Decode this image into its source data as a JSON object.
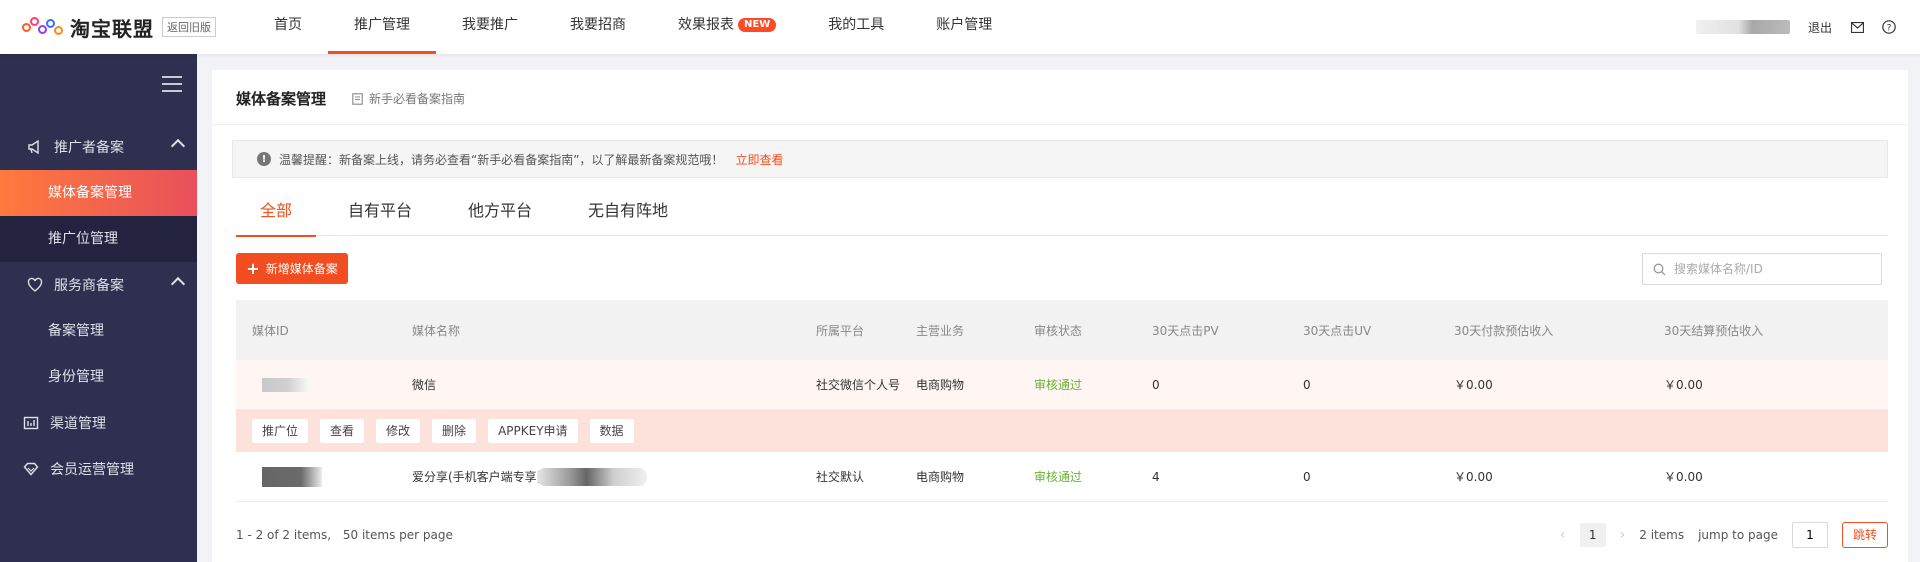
{
  "brand": {
    "name": "淘宝联盟",
    "old_version": "返回旧版"
  },
  "nav": [
    {
      "label": "首页",
      "active": false
    },
    {
      "label": "推广管理",
      "active": true
    },
    {
      "label": "我要推广",
      "active": false
    },
    {
      "label": "我要招商",
      "active": false
    },
    {
      "label": "效果报表",
      "badge": "NEW",
      "active": false
    },
    {
      "label": "我的工具",
      "active": false
    },
    {
      "label": "账户管理",
      "active": false
    }
  ],
  "topright": {
    "logout": "退出"
  },
  "sidebar": {
    "groups": [
      {
        "label": "推广者备案",
        "items": [
          "媒体备案管理",
          "推广位管理"
        ]
      },
      {
        "label": "服务商备案",
        "items": [
          "备案管理",
          "身份管理"
        ]
      },
      {
        "label": "渠道管理"
      },
      {
        "label": "会员运营管理"
      }
    ]
  },
  "page": {
    "title": "媒体备案管理",
    "guide_link": "新手必看备案指南",
    "notice": "温馨提醒：新备案上线，请务必查看“新手必看备案指南”，以了解最新备案规范哦！",
    "notice_link": "立即查看",
    "tabs": [
      "全部",
      "自有平台",
      "他方平台",
      "无自有阵地"
    ],
    "add_button": "新增媒体备案",
    "search_placeholder": "搜索媒体名称/ID"
  },
  "table": {
    "columns": [
      "媒体ID",
      "媒体名称",
      "所属平台",
      "主营业务",
      "审核状态",
      "30天点击PV",
      "30天点击UV",
      "30天付款预估收入",
      "30天结算预估收入"
    ],
    "rows": [
      {
        "name": "微信",
        "platform": "社交微信个人号",
        "business": "电商购物",
        "status": "审核通过",
        "pv": "0",
        "uv": "0",
        "pay": "￥0.00",
        "settle": "￥0.00"
      },
      {
        "name": "爱分享(手机客户端专享)",
        "platform": "社交默认",
        "business": "电商购物",
        "status": "审核通过",
        "pv": "4",
        "uv": "0",
        "pay": "￥0.00",
        "settle": "￥0.00"
      }
    ],
    "actions": [
      "推广位",
      "查看",
      "修改",
      "删除",
      "APPKEY申请",
      "数据"
    ]
  },
  "pagination": {
    "summary": "1 - 2 of 2 items,",
    "per_page": "50 items per page",
    "current": "1",
    "total": "2 items",
    "jump_label": "jump to page",
    "jump_value": "1",
    "go": "跳转"
  },
  "colors": {
    "accent": "#f2501c",
    "sidebar": "#2f2f4f",
    "approved": "#66b331"
  }
}
